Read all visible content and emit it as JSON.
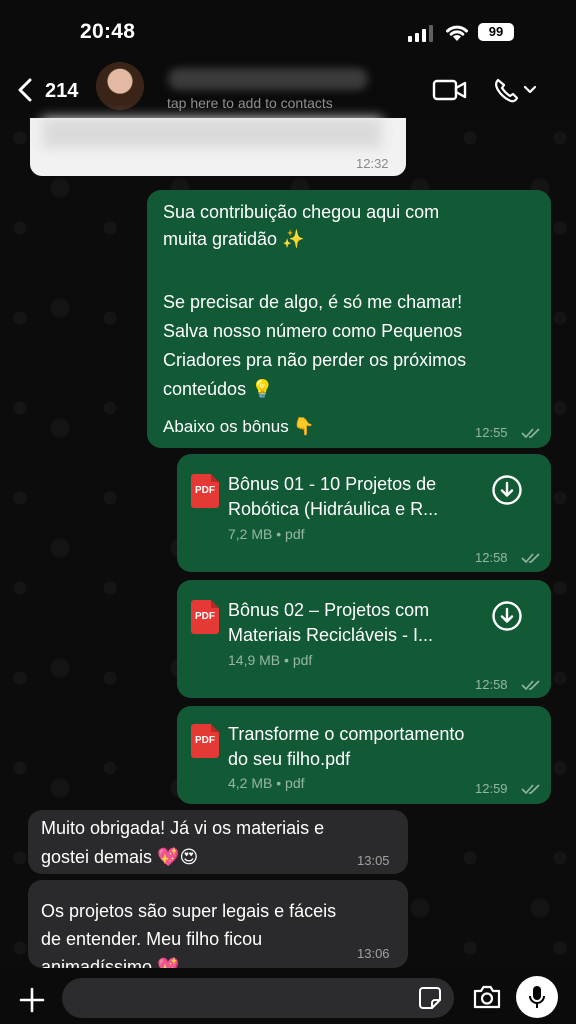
{
  "status_bar": {
    "time": "20:48",
    "battery": "99"
  },
  "header": {
    "back_count": "214",
    "contact_hint": "tap here to add to contacts",
    "icons": [
      "back-icon",
      "video-call-icon",
      "phone-call-icon",
      "chevron-down-icon"
    ]
  },
  "messages": [
    {
      "direction": "incoming",
      "content": "blurred",
      "time": "12:32"
    },
    {
      "direction": "outgoing",
      "lines": [
        "Sua contribuição chegou aqui com",
        "muita gratidão ✨",
        "",
        "Se precisar de algo, é só me chamar!",
        "Salva nosso número como Pequenos",
        "Criadores pra não perder os próximos",
        "conteúdos 💡",
        "Abaixo os bônus 👇"
      ],
      "time": "12:55",
      "status": "read"
    },
    {
      "direction": "outgoing",
      "type": "document",
      "icon_label": "PDF",
      "title_lines": [
        "Bônus 01 - 10 Projetos de",
        "Robótica (Hidráulica e R..."
      ],
      "meta": "7,2 MB • pdf",
      "time": "12:58",
      "downloadable": true
    },
    {
      "direction": "outgoing",
      "type": "document",
      "icon_label": "PDF",
      "title_lines": [
        "Bônus 02 – Projetos com",
        "Materiais Recicláveis - I..."
      ],
      "meta": "14,9 MB • pdf",
      "time": "12:58",
      "downloadable": true
    },
    {
      "direction": "outgoing",
      "type": "document",
      "icon_label": "PDF",
      "title_lines": [
        "Transforme o comportamento",
        "do seu filho.pdf"
      ],
      "meta": "4,2 MB • pdf",
      "time": "12:59",
      "downloadable": false
    },
    {
      "direction": "incoming",
      "lines": [
        "Muito obrigada! Já vi os materiais e",
        "gostei demais 💖😍"
      ],
      "time": "13:05"
    },
    {
      "direction": "incoming",
      "lines": [
        "Os projetos são super legais e fáceis",
        "de entender. Meu filho ficou",
        "animadíssimo 💖"
      ],
      "time": "13:06"
    }
  ],
  "input_bar": {
    "placeholder": "",
    "icons": [
      "plus-icon",
      "sticker-icon",
      "camera-icon",
      "microphone-icon"
    ]
  },
  "colors": {
    "outgoing_bubble": "#125a35",
    "incoming_bubble": "#2a2a2c",
    "background": "#0b0b0b",
    "pdf_red": "#e53935"
  }
}
